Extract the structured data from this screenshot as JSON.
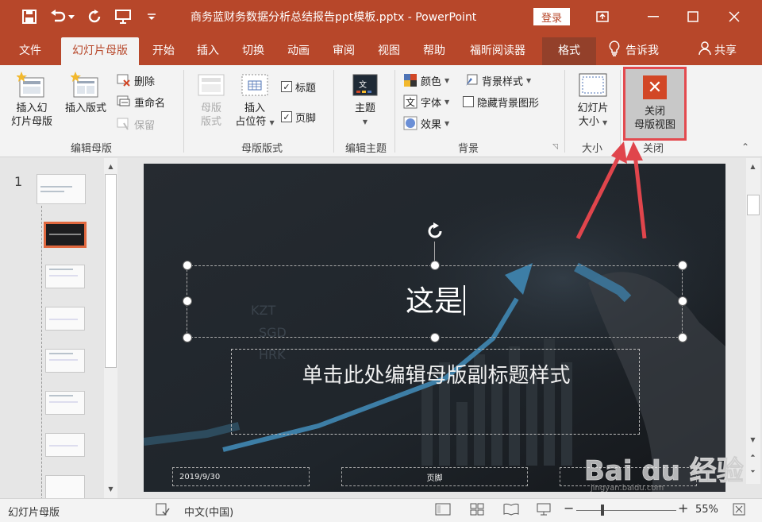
{
  "title_bar": {
    "doc_title": "商务蓝财务数据分析总结报告ppt模板.pptx  -  PowerPoint",
    "login_label": "登录"
  },
  "tabs": [
    "文件",
    "幻灯片母版",
    "开始",
    "插入",
    "切换",
    "动画",
    "审阅",
    "视图",
    "帮助",
    "福昕阅读器",
    "格式"
  ],
  "tell_me": "告诉我",
  "share": "共享",
  "ribbon": {
    "edit_master": {
      "label": "编辑母版",
      "insert_slide_master": [
        "插入幻",
        "灯片母版"
      ],
      "insert_layout": "插入版式",
      "delete": "删除",
      "rename": "重命名",
      "preserve": "保留"
    },
    "master_layout": {
      "label": "母版版式",
      "master_layout_btn": [
        "母版",
        "版式"
      ],
      "insert_placeholder": [
        "插入",
        "占位符"
      ],
      "title_chk": "标题",
      "footer_chk": "页脚"
    },
    "edit_theme": {
      "label": "编辑主题",
      "themes": "主题"
    },
    "background": {
      "label": "背景",
      "colors": "颜色",
      "fonts": "字体",
      "effects": "效果",
      "background_styles": "背景样式",
      "hide_background": "隐藏背景图形"
    },
    "size": {
      "label": "大小",
      "slide_size": [
        "幻灯片",
        "大小"
      ]
    },
    "close": {
      "label": "关闭",
      "close_master_view": [
        "关闭",
        "母版视图"
      ]
    }
  },
  "thumbnail_pane": {
    "slide_number": "1"
  },
  "slide": {
    "title_text": "这是",
    "subtitle_text": "单击此处编辑母版副标题样式",
    "footer_date": "2019/9/30",
    "footer_text": "页脚"
  },
  "status_bar": {
    "view_name": "幻灯片母版",
    "language": "中文(中国)",
    "zoom": "55%",
    "zoom_fraction": 0.55
  },
  "watermark": {
    "brand": "Bai du 经验",
    "url": "jingyan.baidu.com"
  },
  "colors": {
    "accent": "#b7472a",
    "highlight_border": "#e34a4f",
    "close_icon": "#d24726"
  }
}
